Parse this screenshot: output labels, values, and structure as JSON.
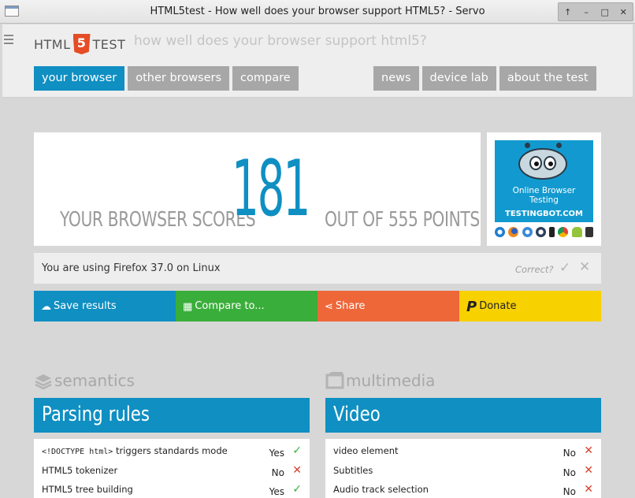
{
  "window": {
    "title": "HTML5test - How well does your browser support HTML5? - Servo",
    "controls": [
      "↑",
      "–",
      "□",
      "✕"
    ]
  },
  "header": {
    "logo_left": "HTML",
    "logo_shield": "5",
    "logo_right": "TEST",
    "tagline": "how well does your browser support html5?"
  },
  "nav": {
    "left": [
      "your browser",
      "other browsers",
      "compare"
    ],
    "right": [
      "news",
      "device lab",
      "about the test"
    ],
    "active": "your browser"
  },
  "score": {
    "prefix": "YOUR BROWSER SCORES",
    "value": "181",
    "suffix": "OUT OF 555 POINTS"
  },
  "ad": {
    "line1": "Online Browser",
    "line2": "Testing",
    "line3": "TESTINGBOT.COM"
  },
  "using": {
    "text": "You are using Firefox 37.0 on Linux",
    "correct": "Correct?"
  },
  "actions": {
    "save": "Save results",
    "compare": "Compare to...",
    "share": "Share",
    "donate": "Donate"
  },
  "sections": {
    "left_title": "semantics",
    "right_title": "multimedia"
  },
  "panels": {
    "left": {
      "title": "Parsing rules",
      "rows": [
        {
          "name_code": "<!DOCTYPE html>",
          "name": " triggers standards mode",
          "value": "Yes",
          "pass": true
        },
        {
          "name": "HTML5 tokenizer",
          "value": "No",
          "pass": false
        },
        {
          "name": "HTML5 tree building",
          "value": "Yes",
          "pass": true
        }
      ]
    },
    "right": {
      "title": "Video",
      "rows": [
        {
          "name": "video element",
          "value": "No",
          "pass": false
        },
        {
          "name": "Subtitles",
          "value": "No",
          "pass": false
        },
        {
          "name": "Audio track selection",
          "value": "No",
          "pass": false
        }
      ]
    }
  },
  "colors": {
    "accent": "#0f8fc2",
    "green": "#3aae3a",
    "orange": "#ee6739",
    "yellow": "#f8d100",
    "tab_grey": "#a7a7a7"
  }
}
